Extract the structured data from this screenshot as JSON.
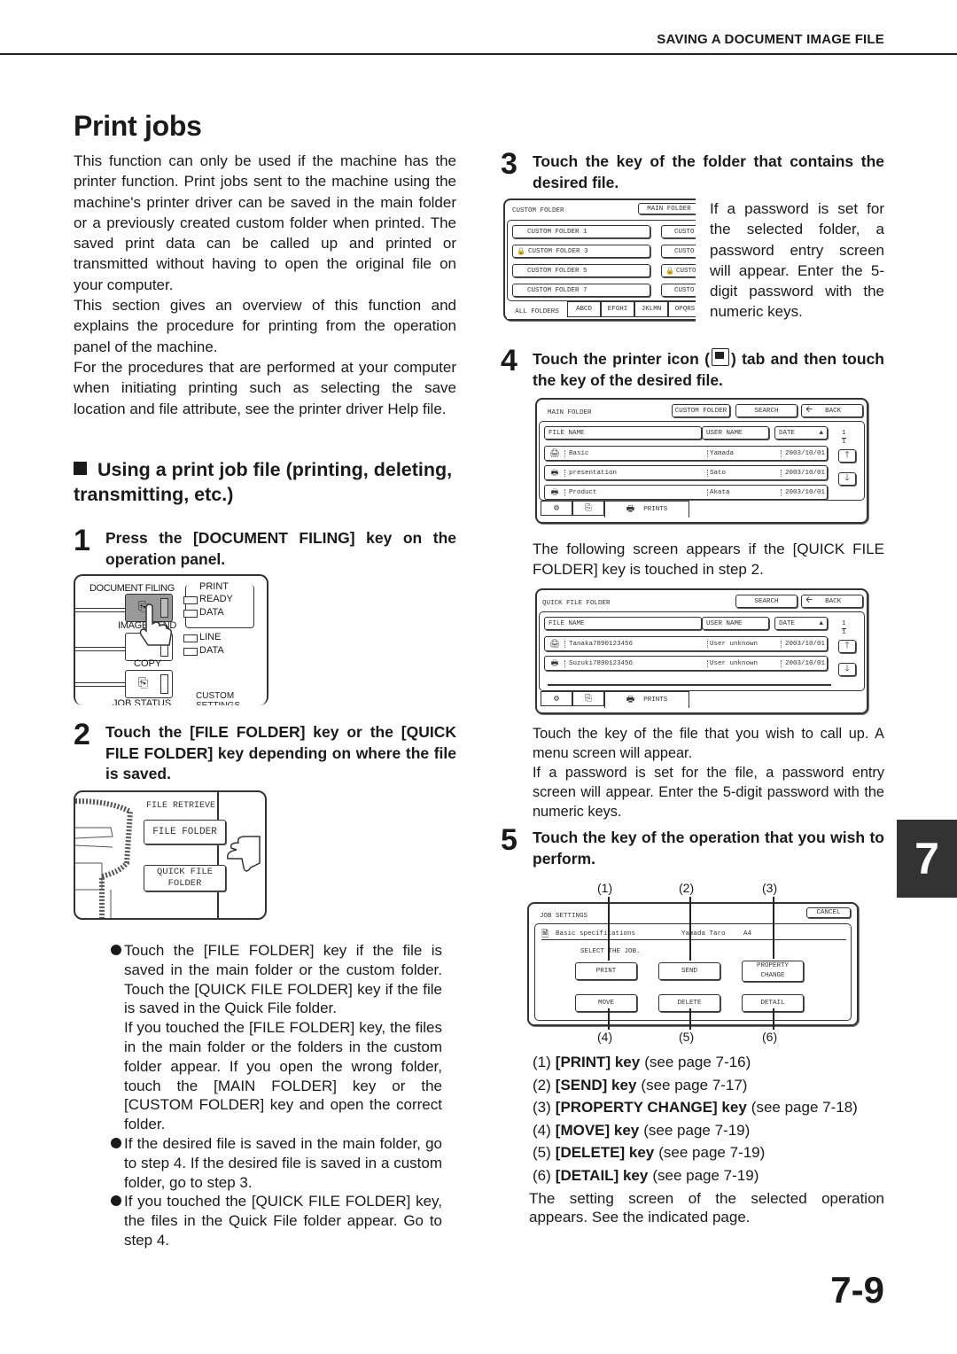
{
  "header": {
    "section_title": "SAVING A DOCUMENT IMAGE FILE"
  },
  "page": {
    "title": "Print jobs",
    "page_number": "7-9",
    "chapter_tab": "7"
  },
  "intro": {
    "p1": "This function can only be used if the machine has the printer function. Print jobs sent to the machine using the machine's printer driver can be saved in the main folder or a previously created custom folder when printed. The saved print data can be called up and printed or transmitted without having to open the original file on your computer.",
    "p2": "This section gives an overview of this function and explains the procedure for printing from the operation panel of the machine.",
    "p3": "For the procedures that are performed at your computer when initiating printing such as selecting the save location and file attribute,  see the printer driver Help file."
  },
  "section": {
    "heading": "Using a print job file (printing, deleting, transmitting, etc.)"
  },
  "steps": [
    {
      "num": "1",
      "text": "Press the [DOCUMENT FILING] key on the operation panel."
    },
    {
      "num": "2",
      "text": "Touch the [FILE FOLDER] key or the [QUICK FILE FOLDER] key depending on where the file is saved."
    },
    {
      "num": "3",
      "text": "Touch the key of the folder that contains the desired file."
    },
    {
      "num": "4",
      "text_before_icon": "Touch the printer icon (",
      "text_after_icon": ") tab and then touch the key of the desired file."
    },
    {
      "num": "5",
      "text": "Touch the key of the operation that you wish to perform."
    }
  ],
  "panel1": {
    "document_filing": "DOCUMENT FILING",
    "image_send": "IMAGE SEND",
    "copy": "COPY",
    "job_status": "JOB STATUS",
    "custom_settings": "CUSTOM SETTINGS",
    "print": "PRINT",
    "ready": "READY",
    "data": "DATA",
    "line": "LINE",
    "line_data": "DATA"
  },
  "panel2": {
    "title": "FILE RETRIEVE",
    "file_folder": "FILE FOLDER",
    "quick_file_line1": "QUICK FILE",
    "quick_file_line2": "FOLDER"
  },
  "step2_bullets": [
    {
      "text": "Touch the [FILE FOLDER] key if the file is saved in the main folder or the custom folder. Touch the [QUICK FILE FOLDER] key if the file is saved in the Quick File folder.",
      "continuation": "If you touched the [FILE FOLDER] key, the files in the main folder or the folders in the custom folder appear. If you open the wrong folder, touch the [MAIN FOLDER] key or the [CUSTOM FOLDER] key and open the correct folder."
    },
    {
      "text": "If the desired file is saved in the main folder, go to step 4. If the desired file is saved in a custom folder, go to step 3."
    },
    {
      "text": "If you touched the [QUICK FILE FOLDER] key, the files in the Quick File folder appear. Go to step 4."
    }
  ],
  "screen_custom": {
    "title": "CUSTOM FOLDER",
    "main_folder": "MAIN FOLDER",
    "folders_left": [
      {
        "label": "CUSTOM FOLDER 1",
        "locked": false
      },
      {
        "label": "CUSTOM FOLDER 3",
        "locked": true
      },
      {
        "label": "CUSTOM FOLDER 5",
        "locked": false
      },
      {
        "label": "CUSTOM FOLDER 7",
        "locked": false
      }
    ],
    "folders_right": [
      {
        "label": "CUSTO",
        "locked": false
      },
      {
        "label": "CUSTO",
        "locked": false
      },
      {
        "label": "CUSTO",
        "locked": true
      },
      {
        "label": "CUSTO",
        "locked": false
      }
    ],
    "tabs": [
      "ALL FOLDERS",
      "ABCD",
      "EFGHI",
      "JKLMN",
      "OPQRS"
    ]
  },
  "step3_note": "If a password is set for the selected folder, a password entry screen will appear. Enter the 5-digit password with the numeric keys.",
  "screen_main": {
    "title": "MAIN FOLDER",
    "custom_folder": "CUSTOM FOLDER",
    "search": "SEARCH",
    "back": "BACK",
    "columns": [
      "FILE NAME",
      "USER NAME",
      "DATE"
    ],
    "rows": [
      {
        "file": "Basic",
        "user": "Yamada",
        "date": "2003/10/01",
        "locked": true
      },
      {
        "file": "presentation",
        "user": "Sato",
        "date": "2003/10/01",
        "locked": false
      },
      {
        "file": "Product",
        "user": "Akata",
        "date": "2003/10/01",
        "locked": false
      }
    ],
    "page_current": "1",
    "page_total": "1",
    "tab_prints": "PRINTS"
  },
  "quick_intro": "The following screen appears if the [QUICK FILE FOLDER] key is touched in step 2.",
  "screen_quick": {
    "title": "QUICK FILE FOLDER",
    "search": "SEARCH",
    "back": "BACK",
    "columns": [
      "FILE NAME",
      "USER NAME",
      "DATE"
    ],
    "rows": [
      {
        "file": "Tanaka7890123456",
        "user": "User unknown",
        "date": "2003/10/01",
        "locked": true
      },
      {
        "file": "Suzuki7890123456",
        "user": "User unknown",
        "date": "2003/10/01",
        "locked": false
      }
    ],
    "page_current": "1",
    "page_total": "1",
    "tab_prints": "PRINTS"
  },
  "step4_notes": {
    "p1": "Touch the key of the file that you wish to call up. A menu screen will appear.",
    "p2": "If a password is set for the file, a password entry screen will appear. Enter the 5-digit password with the numeric keys."
  },
  "screen_job": {
    "title": "JOB SETTINGS",
    "cancel": "CANCEL",
    "file": "Basic specifications",
    "user": "Yamada Taro",
    "size": "A4",
    "prompt": "SELECT THE JOB.",
    "buttons": [
      "PRINT",
      "SEND",
      "PROPERTY CHANGE",
      "MOVE",
      "DELETE",
      "DETAIL"
    ],
    "callouts": [
      "(1)",
      "(2)",
      "(3)",
      "(4)",
      "(5)",
      "(6)"
    ]
  },
  "operations": [
    {
      "num": "(1)",
      "key": "[PRINT] key",
      "ref": "(see page 7-16)"
    },
    {
      "num": "(2)",
      "key": "[SEND] key",
      "ref": "(see page 7-17)"
    },
    {
      "num": "(3)",
      "key": "[PROPERTY CHANGE] key",
      "ref": "(see page 7-18)"
    },
    {
      "num": "(4)",
      "key": "[MOVE] key",
      "ref": "(see page 7-19)"
    },
    {
      "num": "(5)",
      "key": "[DELETE] key",
      "ref": "(see page 7-19)"
    },
    {
      "num": "(6)",
      "key": "[DETAIL] key",
      "ref": "(see page 7-19)"
    }
  ],
  "closing": "The setting screen of the selected operation appears. See the indicated page."
}
